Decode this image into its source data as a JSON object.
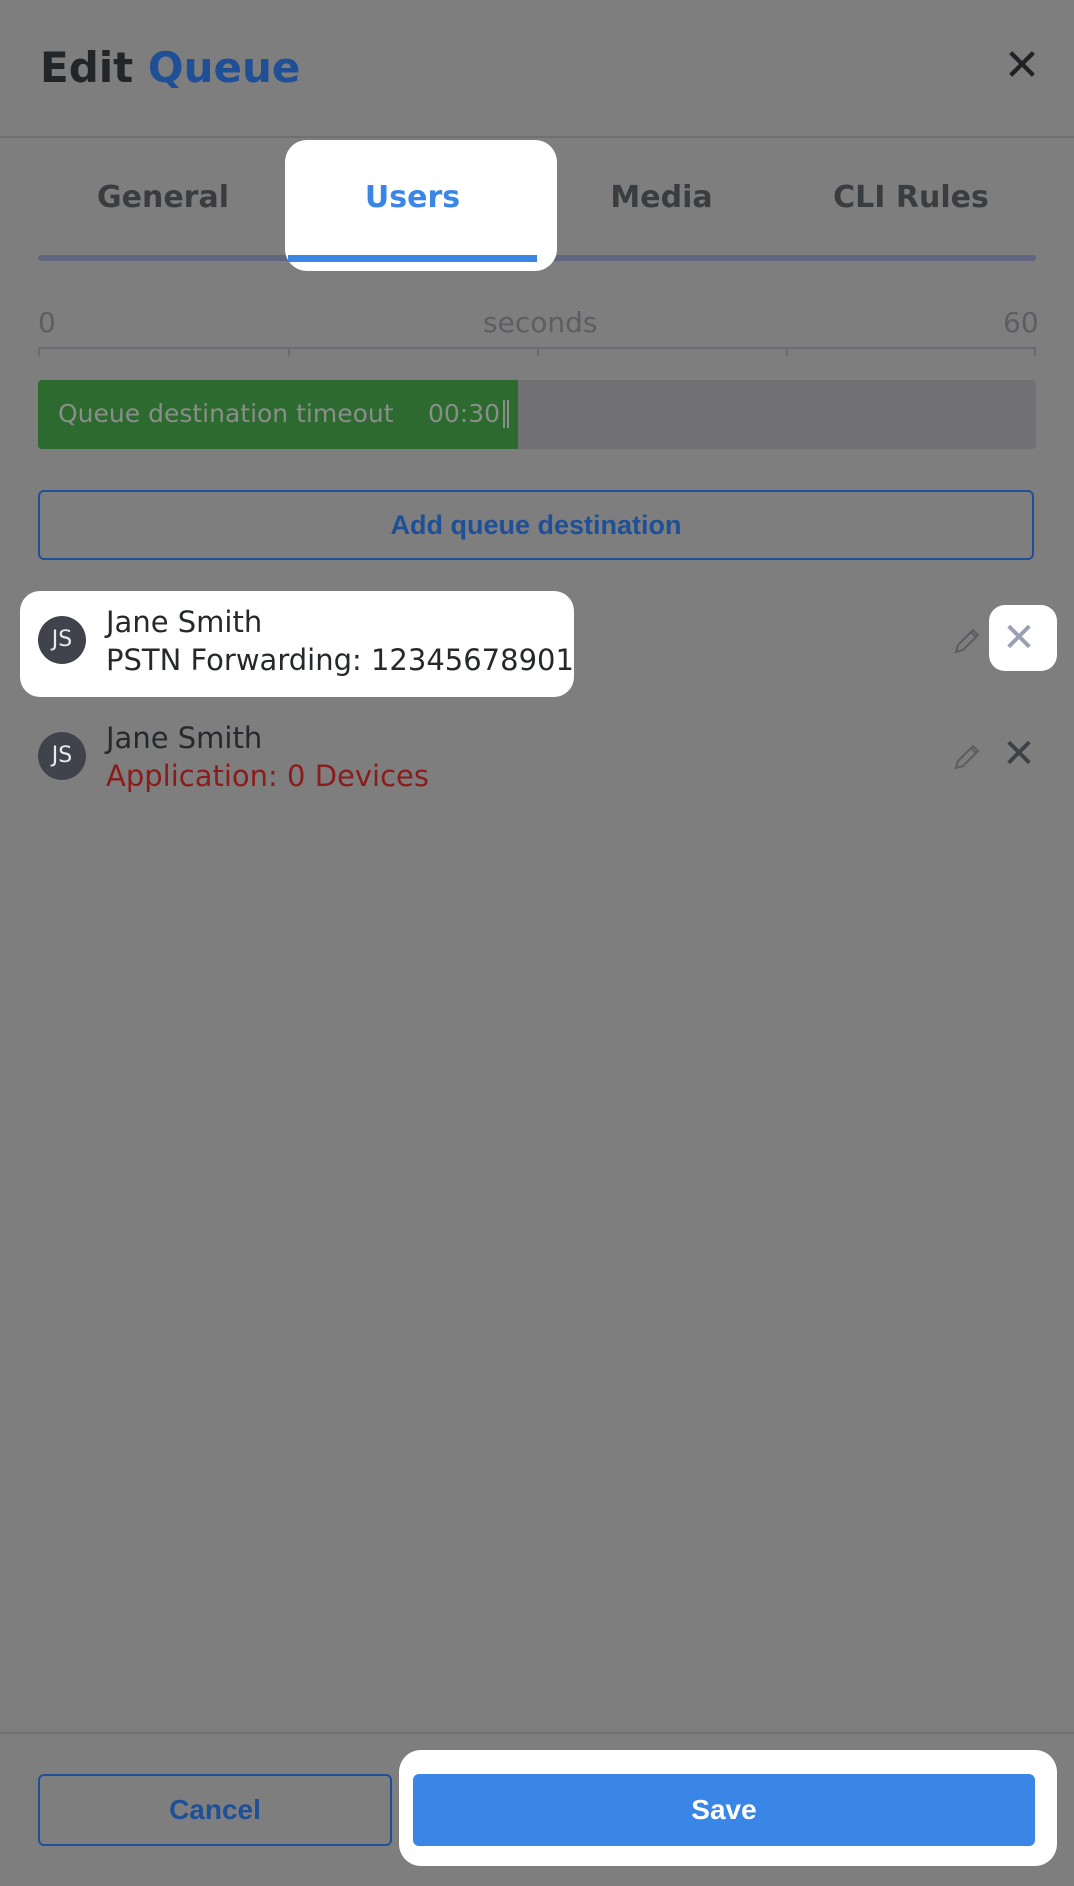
{
  "header": {
    "title_prefix": "Edit",
    "title_accent": "Queue",
    "close_icon": "close-icon"
  },
  "tabs": [
    {
      "label": "General",
      "active": false
    },
    {
      "label": "Users",
      "active": true
    },
    {
      "label": "Media",
      "active": false
    },
    {
      "label": "CLI Rules",
      "active": false
    }
  ],
  "scale": {
    "min_label": "0",
    "mid_label": "seconds",
    "max_label": "60"
  },
  "timeout": {
    "label": "Queue destination timeout",
    "value": "00:30",
    "seconds": 30,
    "max_seconds": 60
  },
  "add_destination_label": "Add queue destination",
  "destinations": [
    {
      "initials": "JS",
      "name": "Jane Smith",
      "detail": "PSTN Forwarding: 12345678901",
      "detail_is_error": false
    },
    {
      "initials": "JS",
      "name": "Jane Smith",
      "detail": "Application: 0 Devices",
      "detail_is_error": true
    }
  ],
  "footer": {
    "cancel_label": "Cancel",
    "save_label": "Save"
  },
  "colors": {
    "accent": "#3a86e6",
    "brand_dark": "#1f4f97",
    "timeout_fill": "#2d6a2f",
    "error_text": "#8b1c1c"
  }
}
